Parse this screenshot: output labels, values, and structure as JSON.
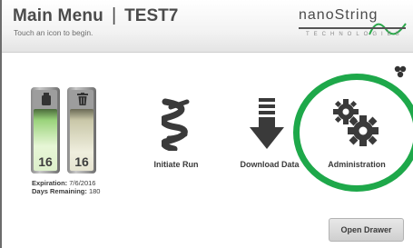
{
  "header": {
    "title": "Main Menu",
    "separator": "|",
    "instrument": "TEST7",
    "subtitle": "Touch an icon to begin."
  },
  "logo": {
    "wordmark": "nanoString",
    "tagline": "TECHNOLOGIES"
  },
  "bays": [
    {
      "count": "16",
      "icon": "bottle-icon"
    },
    {
      "count": "16",
      "icon": "trash-icon"
    }
  ],
  "info": {
    "expiration_label": "Expiration:",
    "expiration_value": "7/6/2016",
    "days_label": "Days Remaining:",
    "days_value": "180"
  },
  "menu": {
    "initiate_run": "Initiate Run",
    "download_data": "Download Data",
    "administration": "Administration"
  },
  "buttons": {
    "open_drawer": "Open Drawer"
  },
  "colors": {
    "highlight_ring": "#1ea84a",
    "logo_accent": "#2aa84a"
  }
}
